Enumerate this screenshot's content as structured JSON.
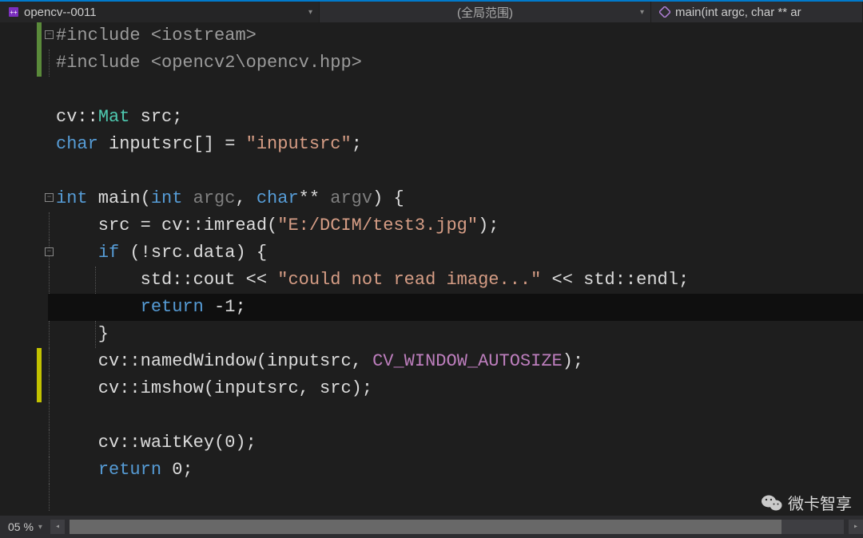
{
  "topbar": {
    "project": "opencv--0011",
    "scope": "(全局范围)",
    "function": "main(int argc, char ** ar"
  },
  "code": {
    "l1_kw": "#include",
    "l1_rest": " <iostream>",
    "l2_kw": "#include",
    "l2_rest": " <opencv2\\opencv.hpp>",
    "l4_a": "cv::",
    "l4_type": "Mat",
    "l4_b": " src;",
    "l5_kw": "char",
    "l5_a": " inputsrc[] = ",
    "l5_str": "\"inputsrc\"",
    "l5_b": ";",
    "l7_kw1": "int",
    "l7_a": " main(",
    "l7_kw2": "int",
    "l7_param1": " argc",
    "l7_b": ", ",
    "l7_kw3": "char",
    "l7_c": "** ",
    "l7_param2": "argv",
    "l7_d": ") {",
    "l8_a": "    src = cv::imread(",
    "l8_str": "\"E:/DCIM/test3.jpg\"",
    "l8_b": ");",
    "l9_kw": "if",
    "l9_a": " (!src.data) {",
    "l10_a": "        std::cout << ",
    "l10_str": "\"could not read image...\"",
    "l10_b": " << std::endl;",
    "l11_kw": "return",
    "l11_a": " -1;",
    "l12_a": "    }",
    "l13_a": "    cv::namedWindow(inputsrc, ",
    "l13_macro": "CV_WINDOW_AUTOSIZE",
    "l13_b": ");",
    "l14_a": "    cv::imshow(inputsrc, src);",
    "l16_a": "    cv::waitKey(0);",
    "l17_kw": "return",
    "l17_a": " 0;"
  },
  "bottom": {
    "zoom": "05 %"
  },
  "watermark": {
    "text": "微卡智享"
  }
}
